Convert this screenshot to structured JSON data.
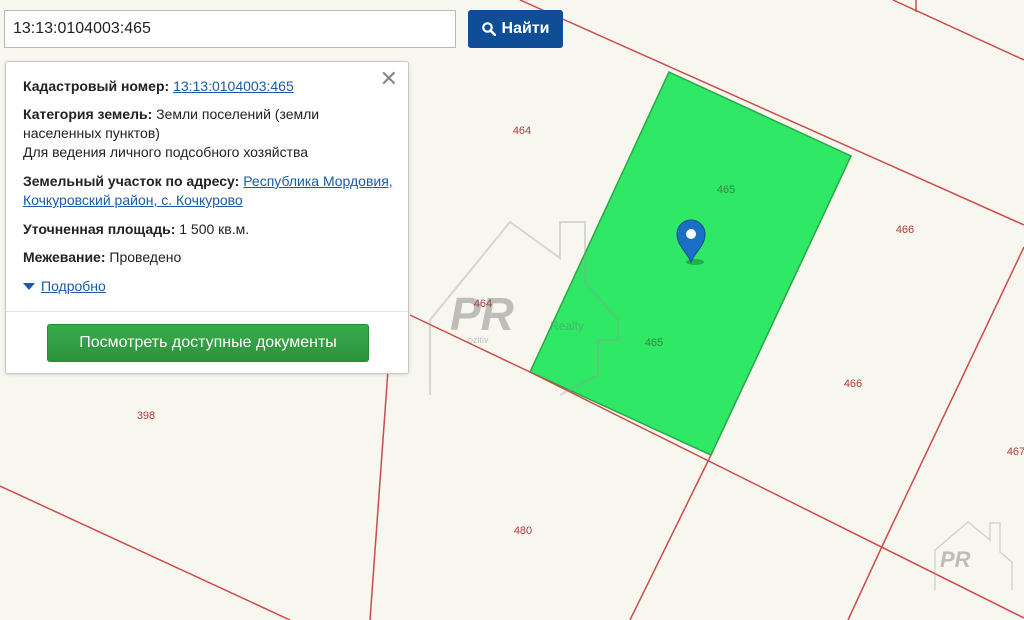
{
  "search": {
    "value": "13:13:0104003:465",
    "button_label": "Найти",
    "button_icon": "search-icon"
  },
  "popup": {
    "cadastral_label": "Кадастровый номер:",
    "cadastral_value": "13:13:0104003:465",
    "category_label": "Категория земель:",
    "category_value_1": "Земли поселений (земли",
    "category_value_2": "населенных пунктов)",
    "category_value_3": "Для ведения личного подсобного хозяйства",
    "address_label": "Земельный участок по адресу:",
    "address_value_1": "Республика Мордовия,",
    "address_value_2": "Кочкуровский район, с. Кочкурово",
    "area_label": "Уточненная площадь:",
    "area_value": "1 500 кв.м.",
    "survey_label": "Межевание:",
    "survey_value": "Проведено",
    "details_label": "Подробно",
    "docs_button": "Посмотреть доступные документы",
    "close_symbol": "✕"
  },
  "map": {
    "parcel_labels": [
      "464",
      "465",
      "465",
      "466",
      "466",
      "467",
      "398",
      "480",
      "464"
    ],
    "selected_fill": "#2ee866",
    "boundary_color": "#cf4a4a",
    "marker": "map-pin-icon",
    "watermark_text": "Realty",
    "watermark_small": "ozitiv",
    "watermark_logo": "PR"
  }
}
